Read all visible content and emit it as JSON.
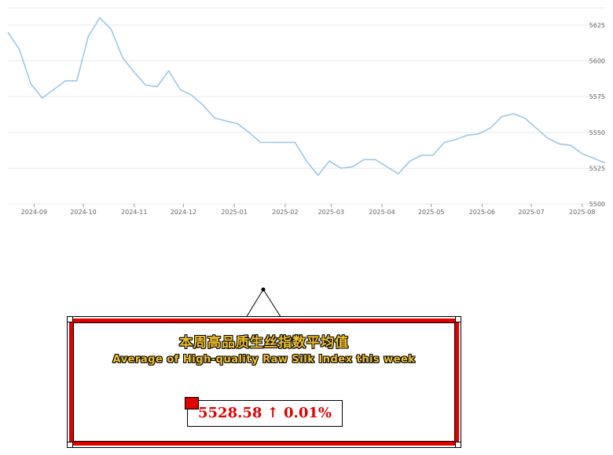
{
  "chart_data": {
    "type": "line",
    "title": "",
    "xlabel": "",
    "ylabel": "",
    "x_start": "2024-08-16",
    "x_end": "2025-08-15",
    "x_ticks": [
      "2024-09",
      "2024-10",
      "2024-11",
      "2024-12",
      "2025-01",
      "2025-02",
      "2025-03",
      "2025-04",
      "2025-05",
      "2025-06",
      "2025-07",
      "2025-08"
    ],
    "y_ticks": [
      5500,
      5525,
      5550,
      5575,
      5600,
      5625
    ],
    "ylim": [
      5500,
      5637
    ],
    "grid": "horizontal",
    "legend": "none",
    "series": [
      {
        "color": "#9cc7ea",
        "points": [
          [
            "2024-08-16",
            5620
          ],
          [
            "2024-08-23",
            5608
          ],
          [
            "2024-08-30",
            5584
          ],
          [
            "2024-09-06",
            5574
          ],
          [
            "2024-09-13",
            5580
          ],
          [
            "2024-09-20",
            5586
          ],
          [
            "2024-09-27",
            5586
          ],
          [
            "2024-10-04",
            5617
          ],
          [
            "2024-10-11",
            5630
          ],
          [
            "2024-10-18",
            5622
          ],
          [
            "2024-10-25",
            5602
          ],
          [
            "2024-11-01",
            5592
          ],
          [
            "2024-11-08",
            5583
          ],
          [
            "2024-11-15",
            5582
          ],
          [
            "2024-11-22",
            5593
          ],
          [
            "2024-11-29",
            5580
          ],
          [
            "2024-12-06",
            5576
          ],
          [
            "2024-12-13",
            5569
          ],
          [
            "2024-12-20",
            5560
          ],
          [
            "2024-12-27",
            5558
          ],
          [
            "2025-01-03",
            5556
          ],
          [
            "2025-01-10",
            5550
          ],
          [
            "2025-01-17",
            5543
          ],
          [
            "2025-01-24",
            5543
          ],
          [
            "2025-02-07",
            5543
          ],
          [
            "2025-02-14",
            5530
          ],
          [
            "2025-02-21",
            5520
          ],
          [
            "2025-02-28",
            5530
          ],
          [
            "2025-03-07",
            5525
          ],
          [
            "2025-03-14",
            5526
          ],
          [
            "2025-03-21",
            5531
          ],
          [
            "2025-03-28",
            5531
          ],
          [
            "2025-04-04",
            5526
          ],
          [
            "2025-04-11",
            5521
          ],
          [
            "2025-04-18",
            5530
          ],
          [
            "2025-04-25",
            5534
          ],
          [
            "2025-05-02",
            5534
          ],
          [
            "2025-05-09",
            5543
          ],
          [
            "2025-05-16",
            5545
          ],
          [
            "2025-05-23",
            5548
          ],
          [
            "2025-05-30",
            5549
          ],
          [
            "2025-06-06",
            5553
          ],
          [
            "2025-06-13",
            5561
          ],
          [
            "2025-06-20",
            5563
          ],
          [
            "2025-06-27",
            5560
          ],
          [
            "2025-07-04",
            5553
          ],
          [
            "2025-07-11",
            5546
          ],
          [
            "2025-07-18",
            5542
          ],
          [
            "2025-07-25",
            5541
          ],
          [
            "2025-08-01",
            5535
          ],
          [
            "2025-08-08",
            5532
          ],
          [
            "2025-08-15",
            5528.58
          ]
        ]
      }
    ]
  },
  "infobox": {
    "title_cn": "本周高品质生丝指数平均值",
    "title_en": "Average of High-quality Raw Silk Index this week",
    "value": "5528.58 ↑ 0.01%"
  },
  "colors": {
    "line": "#9cc7ea",
    "frame": "#e00000",
    "title_text": "#f2c22e",
    "value_text": "#e00000"
  }
}
